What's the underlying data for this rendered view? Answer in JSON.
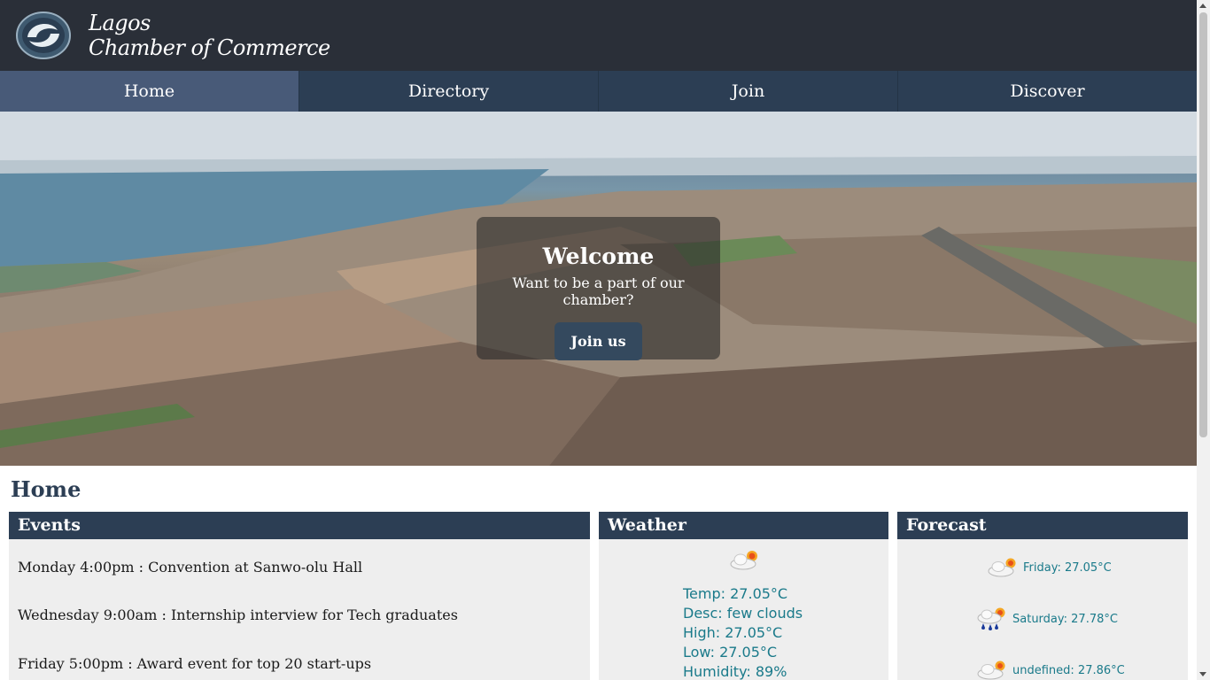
{
  "header": {
    "brand_line1": "Lagos",
    "brand_line2": "Chamber of Commerce",
    "logo_icon": "swirl-logo-icon"
  },
  "nav": {
    "items": [
      {
        "label": "Home",
        "active": true
      },
      {
        "label": "Directory",
        "active": false
      },
      {
        "label": "Join",
        "active": false
      },
      {
        "label": "Discover",
        "active": false
      }
    ]
  },
  "hero": {
    "title": "Welcome",
    "subtitle": "Want to be a part of our chamber?",
    "button_label": "Join us"
  },
  "page_title": "Home",
  "events": {
    "title": "Events",
    "items": [
      "Monday 4:00pm : Convention at Sanwo-olu Hall",
      "Wednesday 9:00am : Internship interview for Tech graduates",
      "Friday 5:00pm : Award event for top 20 start-ups"
    ]
  },
  "weather": {
    "title": "Weather",
    "icon": "few-clouds-icon",
    "temp": "Temp: 27.05°C",
    "desc": "Desc: few clouds",
    "high": "High: 27.05°C",
    "low": "Low: 27.05°C",
    "humidity": "Humidity: 89%"
  },
  "forecast": {
    "title": "Forecast",
    "items": [
      {
        "label": "Friday: 27.05°C",
        "icon": "cloud-sun-icon"
      },
      {
        "label": "Saturday: 27.78°C",
        "icon": "rain-sun-icon"
      },
      {
        "label": "undefined: 27.86°C",
        "icon": "cloud-sun-icon"
      }
    ]
  },
  "colors": {
    "header_bg": "#2a2f38",
    "nav_bg": "#2c3e54",
    "nav_active": "#485a78",
    "card_bg": "#eeeeee",
    "weather_text": "#1a7a8a"
  }
}
